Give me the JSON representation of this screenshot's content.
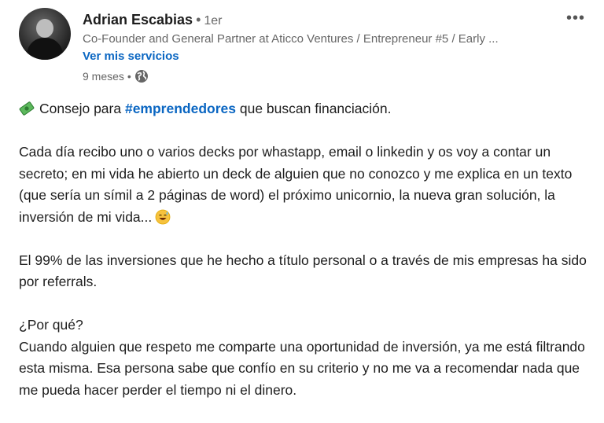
{
  "author": {
    "name": "Adrian Escabias",
    "separator": "•",
    "degree": "1er",
    "headline": "Co-Founder and General Partner at Aticco Ventures / Entrepreneur #5 / Early ...",
    "services_link": "Ver mis servicios",
    "time": "9 meses",
    "meta_separator": "•"
  },
  "menu": {
    "label": "•••"
  },
  "post": {
    "intro_before": "Consejo para ",
    "hashtag": "#emprendedores",
    "intro_after": " que buscan financiación.",
    "p1": "Cada día recibo uno o varios decks por whastapp, email o linkedin y os voy a contar un secreto; en mi vida he abierto un deck de alguien que no conozco y me explica en un texto (que sería un símil a 2 páginas de word) el próximo unicornio, la nueva gran solución, la inversión de mi vida...",
    "p2": "El 99% de las inversiones que he hecho a título personal o a través de mis empresas ha sido por referrals.",
    "q": "¿Por qué?",
    "p3": "Cuando alguien que respeto me comparte una oportunidad de inversión, ya me está filtrando esta misma. Esa persona sabe que confío en su criterio y no me va a recomendar nada que me pueda hacer perder el tiempo ni el dinero."
  },
  "icons": {
    "intro": "money-icon",
    "p1_end": "sweat-smile-emoji-icon",
    "meta": "globe-icon",
    "menu": "more-options-icon"
  }
}
